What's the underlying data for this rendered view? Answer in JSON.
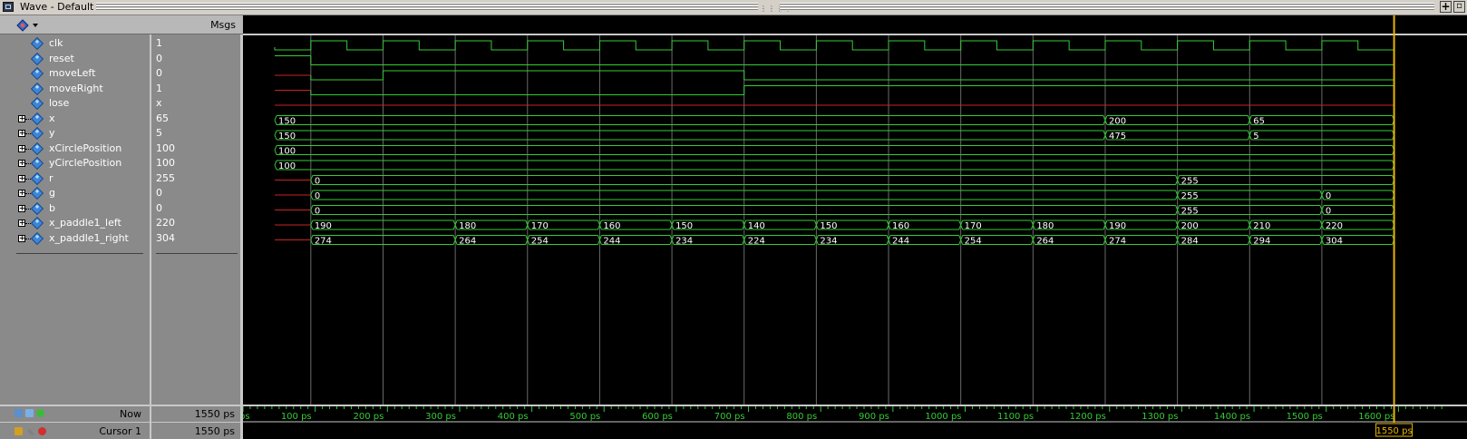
{
  "window": {
    "title": "Wave - Default"
  },
  "header": {
    "msgs_label": "Msgs"
  },
  "signals": [
    {
      "name": "clk",
      "value": "1",
      "expandable": false,
      "kind": "clock"
    },
    {
      "name": "reset",
      "value": "0",
      "expandable": false,
      "kind": "bit"
    },
    {
      "name": "moveLeft",
      "value": "0",
      "expandable": false,
      "kind": "bit"
    },
    {
      "name": "moveRight",
      "value": "1",
      "expandable": false,
      "kind": "bit"
    },
    {
      "name": "lose",
      "value": "x",
      "expandable": false,
      "kind": "bit"
    },
    {
      "name": "x",
      "value": "65",
      "expandable": true,
      "kind": "bus",
      "segments": [
        {
          "t": 0,
          "v": "150"
        },
        {
          "t": 1150,
          "v": "200"
        },
        {
          "t": 1350,
          "v": "65"
        }
      ]
    },
    {
      "name": "y",
      "value": "5",
      "expandable": true,
      "kind": "bus",
      "segments": [
        {
          "t": 0,
          "v": "150"
        },
        {
          "t": 1150,
          "v": "475"
        },
        {
          "t": 1350,
          "v": "5"
        }
      ]
    },
    {
      "name": "xCirclePosition",
      "value": "100",
      "expandable": true,
      "kind": "bus",
      "segments": [
        {
          "t": 0,
          "v": "100"
        }
      ]
    },
    {
      "name": "yCirclePosition",
      "value": "100",
      "expandable": true,
      "kind": "bus",
      "segments": [
        {
          "t": 0,
          "v": "100"
        }
      ]
    },
    {
      "name": "r",
      "value": "255",
      "expandable": true,
      "kind": "bus",
      "segments": [
        {
          "t": 50,
          "v": "0"
        },
        {
          "t": 1250,
          "v": "255"
        }
      ]
    },
    {
      "name": "g",
      "value": "0",
      "expandable": true,
      "kind": "bus",
      "segments": [
        {
          "t": 50,
          "v": "0"
        },
        {
          "t": 1250,
          "v": "255"
        },
        {
          "t": 1450,
          "v": "0"
        }
      ]
    },
    {
      "name": "b",
      "value": "0",
      "expandable": true,
      "kind": "bus",
      "segments": [
        {
          "t": 50,
          "v": "0"
        },
        {
          "t": 1250,
          "v": "255"
        },
        {
          "t": 1450,
          "v": "0"
        }
      ]
    },
    {
      "name": "x_paddle1_left",
      "value": "220",
      "expandable": true,
      "kind": "bus",
      "segments": [
        {
          "t": 50,
          "v": "190"
        },
        {
          "t": 250,
          "v": "180"
        },
        {
          "t": 350,
          "v": "170"
        },
        {
          "t": 450,
          "v": "160"
        },
        {
          "t": 550,
          "v": "150"
        },
        {
          "t": 650,
          "v": "140"
        },
        {
          "t": 750,
          "v": "150"
        },
        {
          "t": 850,
          "v": "160"
        },
        {
          "t": 950,
          "v": "170"
        },
        {
          "t": 1050,
          "v": "180"
        },
        {
          "t": 1150,
          "v": "190"
        },
        {
          "t": 1250,
          "v": "200"
        },
        {
          "t": 1350,
          "v": "210"
        },
        {
          "t": 1450,
          "v": "220"
        }
      ]
    },
    {
      "name": "x_paddle1_right",
      "value": "304",
      "expandable": true,
      "kind": "bus",
      "segments": [
        {
          "t": 50,
          "v": "274"
        },
        {
          "t": 250,
          "v": "264"
        },
        {
          "t": 350,
          "v": "254"
        },
        {
          "t": 450,
          "v": "244"
        },
        {
          "t": 550,
          "v": "234"
        },
        {
          "t": 650,
          "v": "224"
        },
        {
          "t": 750,
          "v": "234"
        },
        {
          "t": 850,
          "v": "244"
        },
        {
          "t": 950,
          "v": "254"
        },
        {
          "t": 1050,
          "v": "264"
        },
        {
          "t": 1150,
          "v": "274"
        },
        {
          "t": 1250,
          "v": "284"
        },
        {
          "t": 1350,
          "v": "294"
        },
        {
          "t": 1450,
          "v": "304"
        }
      ]
    }
  ],
  "bits": {
    "reset": [
      {
        "t": 0,
        "v": 1
      },
      {
        "t": 50,
        "v": 0
      }
    ],
    "moveLeft": [
      {
        "t": 0,
        "v": "x"
      },
      {
        "t": 50,
        "v": 0
      },
      {
        "t": 150,
        "v": 1
      },
      {
        "t": 650,
        "v": 0
      }
    ],
    "moveRight": [
      {
        "t": 0,
        "v": "x"
      },
      {
        "t": 50,
        "v": 0
      },
      {
        "t": 650,
        "v": 1
      }
    ],
    "lose": [
      {
        "t": 0,
        "v": "x"
      }
    ]
  },
  "clock": {
    "first_rise": 50,
    "period": 100,
    "high_time": 50
  },
  "simulation_end_ps": 1550,
  "bottom": {
    "now_label": "Now",
    "now_value": "1550 ps",
    "cursor_label": "Cursor 1",
    "cursor_value": "1550 ps",
    "cursor_time_ps": 1550,
    "cursor_flag": "1550 ps"
  },
  "timeline": {
    "ticks": [
      {
        "t": 0,
        "label": "ps"
      },
      {
        "t": 100,
        "label": "100 ps"
      },
      {
        "t": 200,
        "label": "200 ps"
      },
      {
        "t": 300,
        "label": "300 ps"
      },
      {
        "t": 400,
        "label": "400 ps"
      },
      {
        "t": 500,
        "label": "500 ps"
      },
      {
        "t": 600,
        "label": "600 ps"
      },
      {
        "t": 700,
        "label": "700 ps"
      },
      {
        "t": 800,
        "label": "800 ps"
      },
      {
        "t": 900,
        "label": "900 ps"
      },
      {
        "t": 1000,
        "label": "1000 ps"
      },
      {
        "t": 1100,
        "label": "1100 ps"
      },
      {
        "t": 1200,
        "label": "1200 ps"
      },
      {
        "t": 1300,
        "label": "1300 ps"
      },
      {
        "t": 1400,
        "label": "1400 ps"
      },
      {
        "t": 1500,
        "label": "1500 ps"
      },
      {
        "t": 1600,
        "label": "1600 ps"
      }
    ]
  },
  "colors": {
    "wave": "#33cc33",
    "undefined": "#cc2222",
    "cursor": "#e8b400",
    "bus_text": "#ffffff",
    "grid": "#6a6a6a"
  },
  "icons": {
    "window": "window-icon",
    "toolbar": "signal-tool-icon",
    "signal": "diamond-signal-icon",
    "expand": "plus-box-icon"
  }
}
